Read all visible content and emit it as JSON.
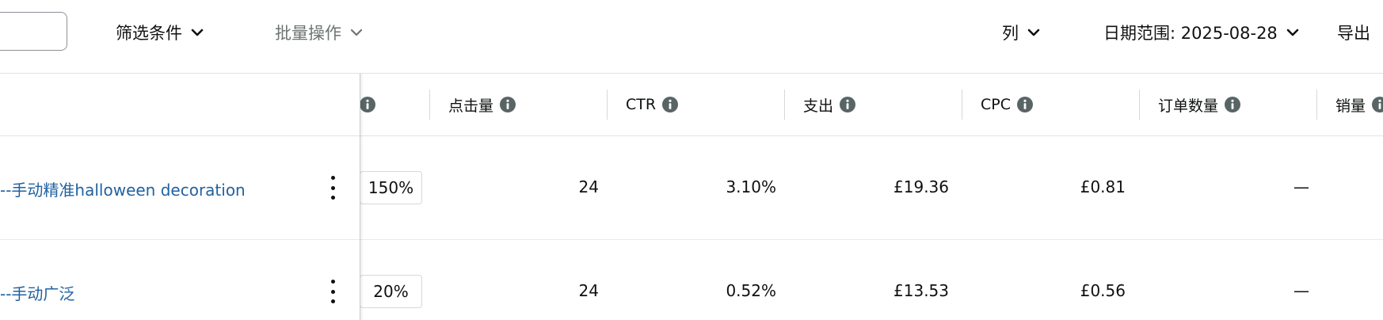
{
  "toolbar": {
    "filter_label": "筛选条件",
    "bulk_label": "批量操作",
    "columns_label": "列",
    "date_range_label": "日期范围: 2025-08-28",
    "export_label": "导出"
  },
  "table": {
    "headers": {
      "clicks": "点击量",
      "ctr": "CTR",
      "spend": "支出",
      "cpc": "CPC",
      "orders": "订单数量",
      "sales": "销量"
    },
    "rows": [
      {
        "name": "--手动精准halloween decoration",
        "bid_adjust": "150%",
        "clicks": "24",
        "ctr": "3.10%",
        "spend": "£19.36",
        "cpc": "£0.81",
        "orders": "—"
      },
      {
        "name": "--手动广泛",
        "bid_adjust": "20%",
        "clicks": "24",
        "ctr": "0.52%",
        "spend": "£13.53",
        "cpc": "£0.56",
        "orders": "—"
      }
    ]
  },
  "colors": {
    "link": "#2162a1",
    "text": "#0f1111",
    "disabled": "#6f7373",
    "border": "#dfe3e6"
  }
}
